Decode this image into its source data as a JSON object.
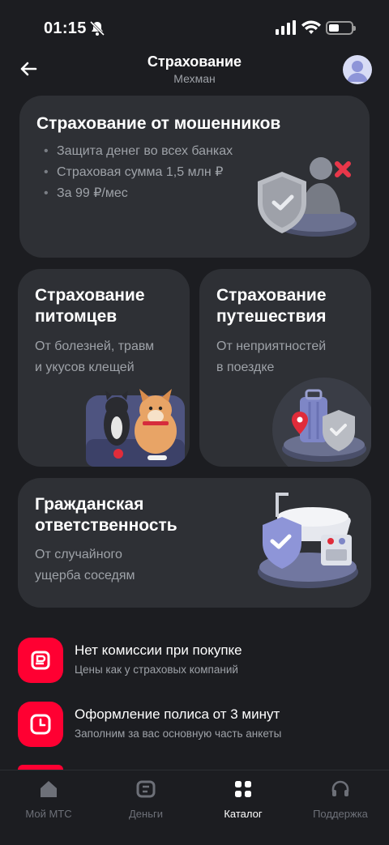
{
  "status_bar": {
    "time": "01:15"
  },
  "header": {
    "title": "Страхование",
    "subtitle": "Мехман"
  },
  "cards": {
    "fraud": {
      "title": "Страхование от мошенников",
      "bullets": [
        "Защита денег во всех банках",
        "Страховая сумма 1,5 млн ₽",
        "За 99 ₽/мес"
      ]
    },
    "pets": {
      "title_line1": "Страхование",
      "title_line2": "питомцев",
      "sub_line1": "От болезней, травм",
      "sub_line2": "и укусов клещей"
    },
    "travel": {
      "title_line1": "Страхование",
      "title_line2": "путешествия",
      "sub_line1": "От неприятностей",
      "sub_line2": "в поездке"
    },
    "liability": {
      "title_line1": "Гражданская",
      "title_line2": "ответственность",
      "sub_line1": "От случайного",
      "sub_line2": "ущерба соседям"
    }
  },
  "features": [
    {
      "title": "Нет комиссии при покупке",
      "subtitle": "Цены как у страховых компаний",
      "icon": "ruble-icon"
    },
    {
      "title": "Оформление полиса от 3 минут",
      "subtitle": "Заполним за вас основную часть анкеты",
      "icon": "clock-icon"
    }
  ],
  "tabs": [
    {
      "label": "Мой МТС",
      "icon": "home-icon",
      "active": false
    },
    {
      "label": "Деньги",
      "icon": "wallet-icon",
      "active": false
    },
    {
      "label": "Каталог",
      "icon": "catalog-icon",
      "active": true
    },
    {
      "label": "Поддержка",
      "icon": "headset-icon",
      "active": false
    }
  ],
  "colors": {
    "background": "#1c1d21",
    "card": "#2e3035",
    "accent": "#ff0032",
    "muted_text": "#9ea2a8"
  }
}
